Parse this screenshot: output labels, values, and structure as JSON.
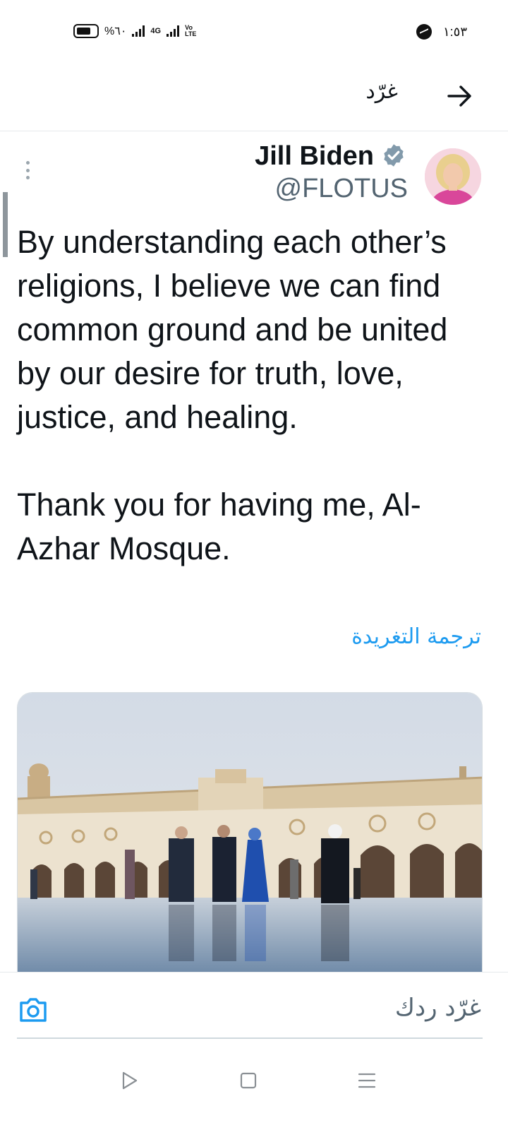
{
  "status_bar": {
    "battery_percent": "%٦٠",
    "network_label": "4G",
    "volte_label": "Vo LTE",
    "time": "١:٥٣"
  },
  "header": {
    "title": "غرّد"
  },
  "tweet": {
    "author_name": "Jill Biden",
    "handle": "@FLOTUS",
    "text_paragraph_1": "By understanding each other’s religions, I believe we can find common ground and be united by our desire for truth, love, justice, and healing.",
    "text_paragraph_2": "Thank you for having me, Al-Azhar Mosque.",
    "translate_label": "ترجمة التغريدة"
  },
  "reply": {
    "placeholder": "غرّد ردك"
  },
  "colors": {
    "link": "#1d9bf0",
    "handle": "#536471",
    "text": "#0f1419",
    "verified": "#829aab"
  },
  "icons": {
    "back": "arrow-right-icon",
    "more": "more-vertical-icon",
    "verified": "verified-badge-icon",
    "camera": "camera-icon",
    "nav_back": "triangle-back-icon",
    "nav_home": "square-home-icon",
    "nav_menu": "menu-lines-icon"
  }
}
